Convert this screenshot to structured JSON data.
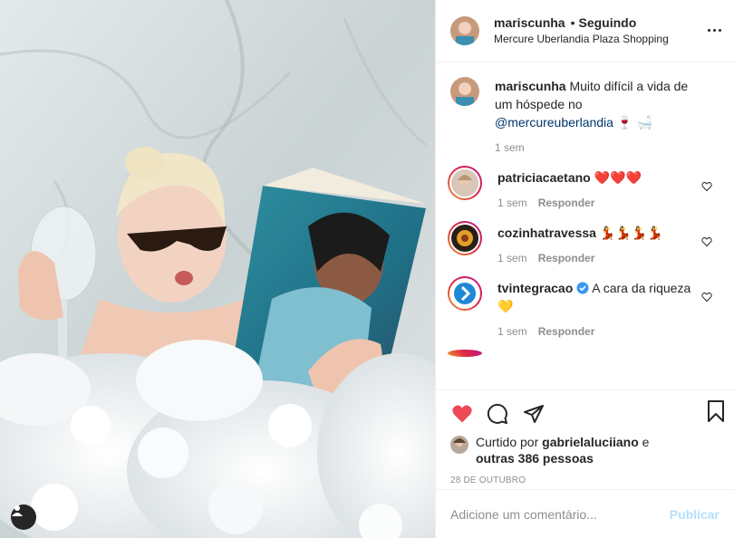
{
  "colors": {
    "like": "#ed4956",
    "link": "#00376b",
    "muted": "#8e8e8e",
    "publish": "#b2dffc"
  },
  "header": {
    "username": "mariscunha",
    "separator": "•",
    "follow_status": "Seguindo",
    "location": "Mercure Uberlandia Plaza Shopping",
    "more_icon": "more-horizontal-icon"
  },
  "caption": {
    "username": "mariscunha",
    "text": "Muito difícil a vida de um hóspede no",
    "mention": "@mercureuberlandia",
    "emojis": "🍷 🛁",
    "time": "1 sem"
  },
  "comments": [
    {
      "username": "patriciacaetano",
      "text": "",
      "emoji": "❤️❤️❤️",
      "time": "1 sem",
      "reply": "Responder"
    },
    {
      "username": "cozinhatravessa",
      "text": "",
      "emoji": "💃💃💃💃",
      "time": "1 sem",
      "reply": "Responder"
    },
    {
      "username": "tvintegracao",
      "verified": true,
      "text": "A cara da riqueza",
      "emoji": "💛",
      "time": "1 sem",
      "reply": "Responder"
    }
  ],
  "actions": {
    "liked_prefix": "Curtido por",
    "liked_user": "gabrielaluciiano",
    "liked_and": "e",
    "liked_others": "outras 386 pessoas",
    "date": "28 DE OUTUBRO"
  },
  "comment_box": {
    "placeholder": "Adicione um comentário...",
    "publish": "Publicar"
  }
}
